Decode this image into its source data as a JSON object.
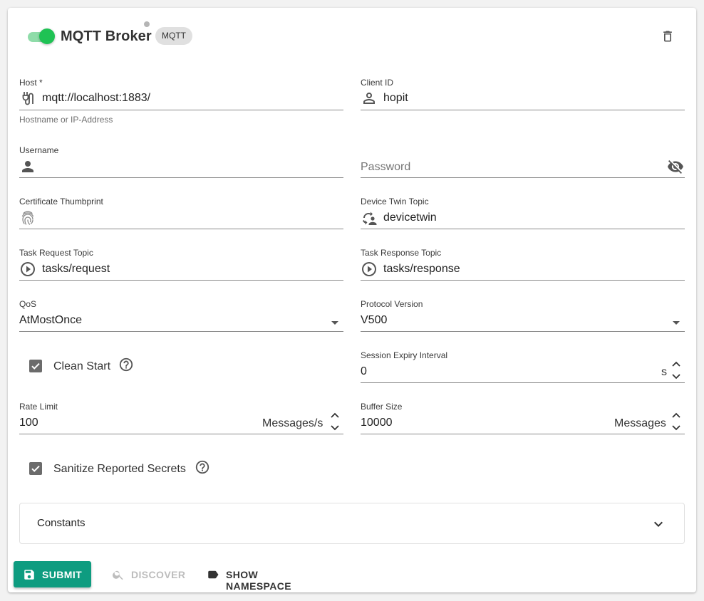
{
  "header": {
    "title": "MQTT Broker",
    "chip": "MQTT",
    "toggle_on": true,
    "toggle_color": "#1fc254",
    "delete_icon": "trash-icon"
  },
  "fields": {
    "host": {
      "label": "Host *",
      "value": "mqtt://localhost:1883/",
      "hint": "Hostname or IP-Address",
      "icon": "plug-icon"
    },
    "client_id": {
      "label": "Client ID",
      "value": "hopit",
      "icon": "person-outline-icon"
    },
    "username": {
      "label": "Username",
      "value": "",
      "icon": "person-icon"
    },
    "password": {
      "placeholder": "Password",
      "value": "",
      "icon": "eye-off-icon"
    },
    "cert_thumbprint": {
      "label": "Certificate Thumbprint",
      "value": "",
      "icon": "fingerprint-icon"
    },
    "device_twin_topic": {
      "label": "Device Twin Topic",
      "value": "devicetwin",
      "icon": "sync-person-icon"
    },
    "task_request_topic": {
      "label": "Task Request Topic",
      "value": "tasks/request",
      "icon": "play-circle-icon"
    },
    "task_response_topic": {
      "label": "Task Response Topic",
      "value": "tasks/response",
      "icon": "play-circle-icon"
    },
    "qos": {
      "label": "QoS",
      "value": "AtMostOnce"
    },
    "protocol_version": {
      "label": "Protocol Version",
      "value": "V500"
    },
    "session_expiry": {
      "label": "Session Expiry Interval",
      "value": "0",
      "unit": "s"
    },
    "rate_limit": {
      "label": "Rate Limit",
      "value": "100",
      "unit": "Messages/s"
    },
    "buffer_size": {
      "label": "Buffer Size",
      "value": "10000",
      "unit": "Messages"
    }
  },
  "checkboxes": {
    "clean_start": {
      "label": "Clean Start",
      "checked": true
    },
    "sanitize": {
      "label": "Sanitize Reported Secrets",
      "checked": true
    }
  },
  "expander": {
    "title": "Constants"
  },
  "actions": {
    "submit": "SUBMIT",
    "discover": "DISCOVER",
    "show_namespace": "SHOW NAMESPACE"
  },
  "colors": {
    "primary": "#0e9c80",
    "toggle": "#1fc254",
    "disabled": "#bdbdbd"
  }
}
